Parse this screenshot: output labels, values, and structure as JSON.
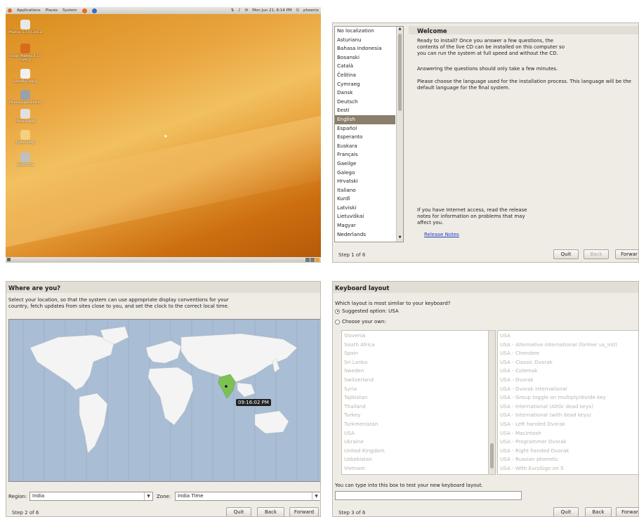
{
  "desktop": {
    "menu": [
      "Applications",
      "Places",
      "System"
    ],
    "clock": "Mon Jun 21,  8:14 PM",
    "user": "phoenix",
    "icons": [
      {
        "label": "Phoenix 5.1.0 LiveCD",
        "color": "#e8e8e8"
      },
      {
        "label": "Install Phoenix 5.1.0 LiveCD",
        "color": "#d86b1c"
      },
      {
        "label": "LearnByCoding",
        "color": "#f0f0f0"
      },
      {
        "label": "PhoenixExperiments",
        "color": "#9aa0a8"
      },
      {
        "label": "PhoenixHelp",
        "color": "#e0e0e0"
      },
      {
        "label": "PythonHelp",
        "color": "#f4d080"
      },
      {
        "label": "KINGSTON",
        "color": "#c0c0c0"
      }
    ]
  },
  "welcome": {
    "title": "Welcome",
    "p1": "Ready to install? Once you answer a few questions, the contents of the live CD can be installed on this computer so you can run the system at full speed and without the CD.",
    "p2": "Answering the questions should only take a few minutes.",
    "p3": "Please choose the language used for the installation process. This language will be the default language for the final system.",
    "p4": "If you have Internet access, read the release notes for information on problems that may affect you.",
    "link": "Release Notes",
    "languages": [
      "No localization",
      "Asturianu",
      "Bahasa Indonesia",
      "Bosanski",
      "Català",
      "Čeština",
      "Cymraeg",
      "Dansk",
      "Deutsch",
      "Eesti",
      "English",
      "Español",
      "Esperanto",
      "Euskara",
      "Français",
      "Gaeilge",
      "Galego",
      "Hrvatski",
      "Italiano",
      "Kurdî",
      "Latviski",
      "Lietuviškai",
      "Magyar",
      "Nederlands"
    ],
    "selected": "English",
    "step": "Step 1 of 6",
    "quit": "Quit",
    "back": "Back",
    "forward": "Forwar"
  },
  "location": {
    "title": "Where are you?",
    "desc": "Select your location, so that the system can use appropriate display conventions for your country, fetch updates from sites close to you, and set the clock to the correct local time.",
    "time": "09:16:02 PM",
    "region_label": "Region:",
    "region": "India",
    "zone_label": "Zone:",
    "zone": "India Time",
    "step": "Step 2 of 6",
    "quit": "Quit",
    "back": "Back",
    "forward": "Forward",
    "colors": {
      "ocean": "#a9bdd4",
      "land": "#f4f4f4",
      "selected": "#7cc253"
    }
  },
  "keyboard": {
    "title": "Keyboard layout",
    "question": "Which layout is most similar to your keyboard?",
    "suggested": "Suggested option:  USA",
    "choose": "Choose your own:",
    "countries": [
      "Slovenia",
      "South Africa",
      "Spain",
      "Sri Lanka",
      "Sweden",
      "Switzerland",
      "Syria",
      "Tajikistan",
      "Thailand",
      "Turkey",
      "Turkmenistan",
      "USA",
      "Ukraine",
      "United Kingdom",
      "Uzbekistan",
      "Vietnam"
    ],
    "variants": [
      "USA",
      "USA - Alternative international (former us_intl)",
      "USA - Cherokee",
      "USA - Classic Dvorak",
      "USA - Colemak",
      "USA - Dvorak",
      "USA - Dvorak international",
      "USA - Group toggle on multiply/divide key",
      "USA - International (AltGr dead keys)",
      "USA - International (with dead keys)",
      "USA - Left handed Dvorak",
      "USA - Macintosh",
      "USA - Programmer Dvorak",
      "USA - Right handed Dvorak",
      "USA - Russian phonetic",
      "USA - With EuroSign on 5"
    ],
    "test_label": "You can type into this box to test your new keyboard layout.",
    "test_value": "",
    "step": "Step 3 of 6",
    "quit": "Quit",
    "back": "Back",
    "forward": "Forwar"
  }
}
